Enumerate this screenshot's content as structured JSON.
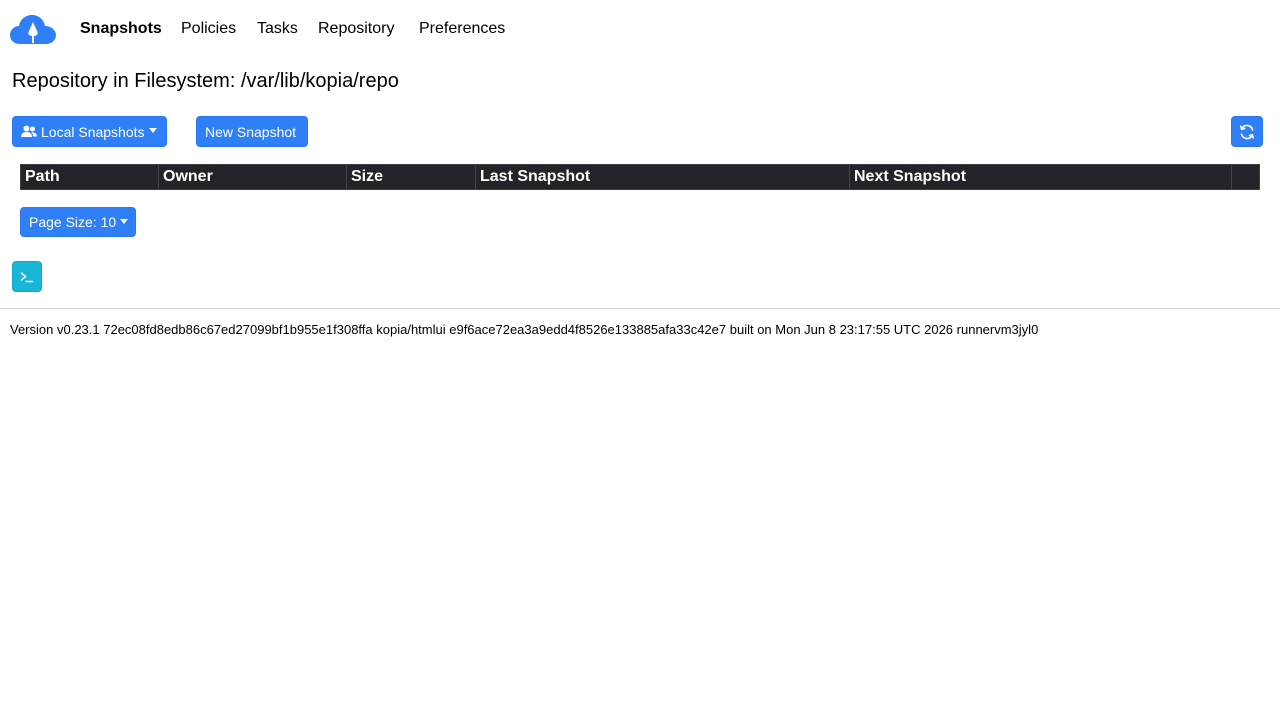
{
  "nav": {
    "items": [
      {
        "label": "Snapshots",
        "active": true
      },
      {
        "label": "Policies"
      },
      {
        "label": "Tasks"
      },
      {
        "label": "Repository"
      },
      {
        "label": "Preferences"
      }
    ],
    "logo_icon": "kopia-cloud-logo-icon"
  },
  "page": {
    "title": "Repository in Filesystem: /var/lib/kopia/repo"
  },
  "toolbar": {
    "local_snapshots_label": "Local Snapshots",
    "local_snapshots_icon": "users-icon",
    "new_snapshot_label": "New Snapshot",
    "refresh_icon": "refresh-icon"
  },
  "table": {
    "columns": [
      "Path",
      "Owner",
      "Size",
      "Last Snapshot",
      "Next Snapshot",
      ""
    ]
  },
  "pagination": {
    "page_size_label": "Page Size: 10"
  },
  "terminal": {
    "icon": "terminal-icon"
  },
  "footer": {
    "version_text": "Version v0.23.1 72ec08fd8edb86c67ed27099bf1b955e1f308ffa kopia/htmlui e9f6ace72ea3a9edd4f8526e133885afa33c42e7 built on Mon Jun 8 23:17:55 UTC 2026 runnervm3jyl0"
  },
  "colors": {
    "primary": "#2f80f6",
    "info": "#19b5d6",
    "table_header": "#212529",
    "logo": "#2f80f6"
  }
}
